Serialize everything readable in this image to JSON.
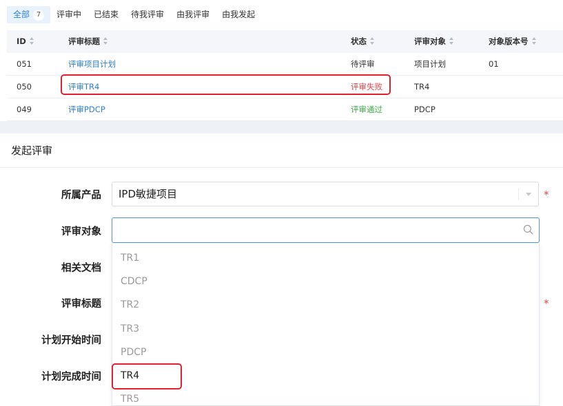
{
  "tabs": [
    {
      "label": "全部",
      "count": "7"
    },
    {
      "label": "评审中"
    },
    {
      "label": "已结束"
    },
    {
      "label": "待我评审"
    },
    {
      "label": "由我评审"
    },
    {
      "label": "由我发起"
    }
  ],
  "table": {
    "headers": {
      "id": "ID",
      "title": "评审标题",
      "status": "状态",
      "object": "评审对象",
      "version": "对象版本号"
    },
    "rows": [
      {
        "id": "051",
        "title": "评审项目计划",
        "status": "待评审",
        "object": "项目计划",
        "version": "01"
      },
      {
        "id": "050",
        "title": "评审TR4",
        "status": "评审失败",
        "object": "TR4",
        "version": ""
      },
      {
        "id": "049",
        "title": "评审PDCP",
        "status": "评审通过",
        "object": "PDCP",
        "version": ""
      }
    ]
  },
  "form": {
    "title": "发起评审",
    "labels": {
      "product": "所属产品",
      "object": "评审对象",
      "docs": "相关文档",
      "title": "评审标题",
      "plan_start": "计划开始时间",
      "plan_end": "计划完成时间"
    },
    "product_value": "IPD敏捷项目",
    "object_search_value": "",
    "required_mark": "*"
  },
  "dropdown_options": [
    "TR1",
    "CDCP",
    "TR2",
    "TR3",
    "PDCP",
    "TR4",
    "TR5"
  ],
  "colors": {
    "accent": "#2d7fd3",
    "fail": "#e5484d",
    "pass": "#3fae4c",
    "highlight": "#e3202f"
  },
  "icons": {
    "search": "search-icon",
    "caret": "chevron-down-icon",
    "sort": "sort-icon"
  }
}
